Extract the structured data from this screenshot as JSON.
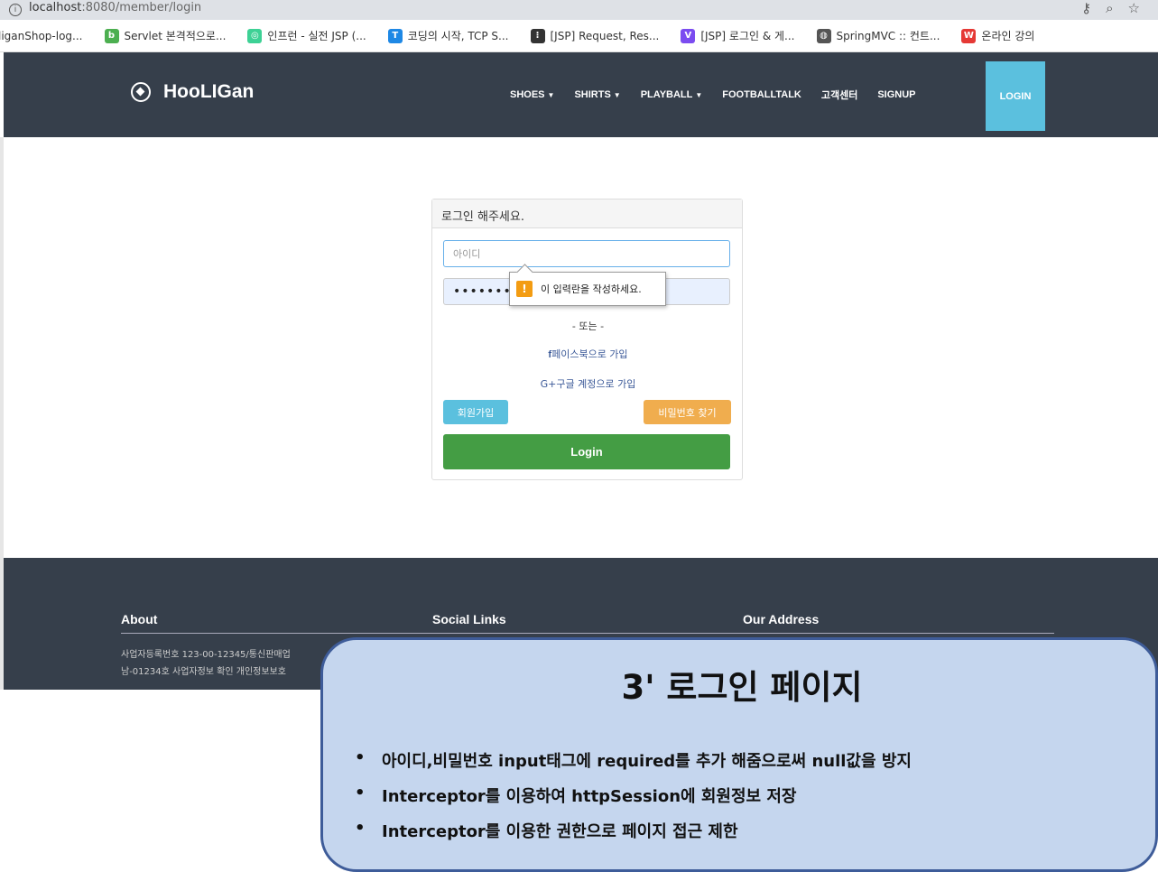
{
  "browser": {
    "url_host": "localhost",
    "url_port_path": ":8080/member/login",
    "bookmarks": [
      {
        "label": "liganShop-log...",
        "icon": "bookmark-icon",
        "color": "#ffffff"
      },
      {
        "label": "Servlet 본격적으로...",
        "icon": "blog-icon",
        "color": "#4caf50"
      },
      {
        "label": "인프런 - 실전 JSP (...",
        "icon": "inflearn-icon",
        "color": "#3dd195"
      },
      {
        "label": "코딩의 시작, TCP S...",
        "icon": "tistory-t-icon",
        "color": "#1e88e5"
      },
      {
        "label": "[JSP] Request, Res...",
        "icon": "dots-icon",
        "color": "#333333"
      },
      {
        "label": "[JSP] 로그인 & 게...",
        "icon": "velog-v-icon",
        "color": "#7b4cf0"
      },
      {
        "label": "SpringMVC :: 컨트...",
        "icon": "site-icon",
        "color": "#555555"
      },
      {
        "label": "온라인 강의",
        "icon": "w-icon",
        "color": "#e53935"
      }
    ]
  },
  "navbar": {
    "brand": "HooLIGan",
    "items": [
      "SHOES",
      "SHIRTS",
      "PLAYBALL",
      "FOOTBALLTALK",
      "고객센터",
      "SIGNUP"
    ],
    "login": "LOGIN",
    "bg_color": "#363f4b",
    "login_color": "#5bc0de"
  },
  "login": {
    "heading": "로그인 해주세요.",
    "id_placeholder": "아이디",
    "password_value": "••••••••",
    "tooltip": "이 입력란을 작성하세요.",
    "or_text": "- 또는 -",
    "facebook": "페이스북으로 가입",
    "google": "G+구글 계정으로 가입",
    "join": "회원가입",
    "find_password": "비밀번호 찾기",
    "submit": "Login"
  },
  "footer": {
    "about": "About",
    "social": "Social Links",
    "address": "Our Address",
    "line1": "사업자등록번호 123-00-12345/통신판매업",
    "line2": "남-01234호 사업자정보 확인 개인정보보호"
  },
  "callout": {
    "title": "3' 로그인 페이지",
    "bullets": [
      "아이디,비밀번호 input태그에 required를 추가 해줌으로써 null값을 방지",
      "Interceptor를 이용하여 httpSession에 회원정보 저장",
      "Interceptor를 이용한 권한으로 페이지 접근 제한"
    ]
  }
}
